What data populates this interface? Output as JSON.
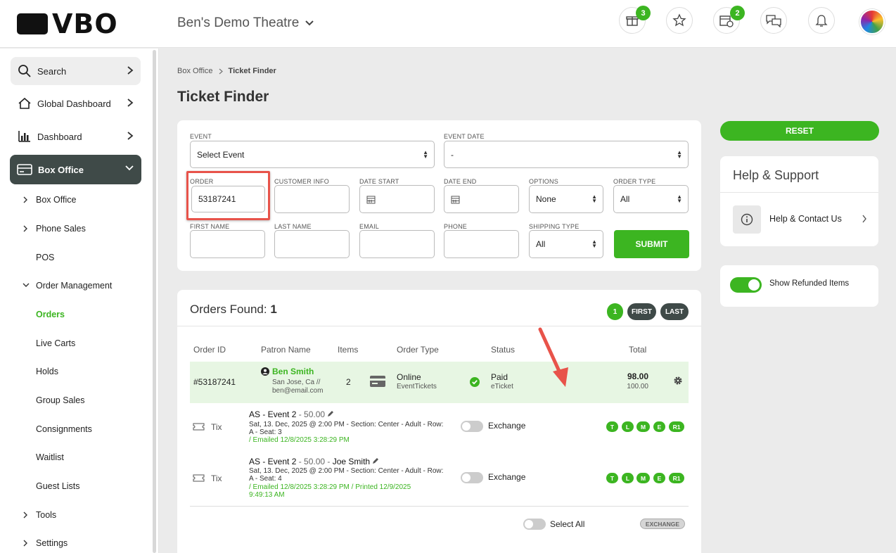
{
  "brand": {
    "logo_text": "VBO",
    "venue": "Ben's Demo Theatre"
  },
  "topbar": {
    "icons": [
      {
        "name": "gift-icon",
        "badge": "3"
      },
      {
        "name": "star-icon",
        "badge": ""
      },
      {
        "name": "calendar-clock-icon",
        "badge": "2"
      },
      {
        "name": "chat-icon",
        "badge": ""
      },
      {
        "name": "bell-icon",
        "badge": ""
      }
    ]
  },
  "sidebar": {
    "search": "Search",
    "global_dashboard": "Global Dashboard",
    "dashboard": "Dashboard",
    "box_office": "Box Office",
    "items": [
      "Box Office",
      "Phone Sales",
      "POS",
      "Order Management",
      "Orders",
      "Live Carts",
      "Holds",
      "Group Sales",
      "Consignments",
      "Waitlist",
      "Guest Lists",
      "Tools",
      "Settings"
    ]
  },
  "breadcrumb": {
    "root": "Box Office",
    "current": "Ticket Finder"
  },
  "page_title": "Ticket Finder",
  "form": {
    "event_label": "EVENT",
    "event_value": "Select Event",
    "event_date_label": "EVENT DATE",
    "event_date_value": "-",
    "order_label": "ORDER",
    "order_value": "53187241",
    "customer_info_label": "CUSTOMER INFO",
    "date_start_label": "DATE START",
    "date_end_label": "DATE END",
    "options_label": "OPTIONS",
    "options_value": "None",
    "order_type_label": "ORDER TYPE",
    "order_type_value": "All",
    "first_name_label": "FIRST NAME",
    "last_name_label": "LAST NAME",
    "email_label": "EMAIL",
    "phone_label": "PHONE",
    "shipping_label": "SHIPPING TYPE",
    "shipping_value": "All",
    "submit": "SUBMIT"
  },
  "results": {
    "title": "Orders Found:",
    "count": "1",
    "page": "1",
    "first": "FIRST",
    "last": "LAST",
    "headers": {
      "order_id": "Order ID",
      "patron": "Patron Name",
      "items": "Items",
      "order_type": "Order Type",
      "status": "Status",
      "total": "Total"
    },
    "order": {
      "id": "#53187241",
      "patron": "Ben Smith",
      "location": "San Jose, Ca //",
      "email": "ben@email.com",
      "items": "2",
      "type": "Online",
      "type_sub": "EventTickets",
      "status": "Paid",
      "status_sub": "eTicket",
      "total": "98.00",
      "total_sub": "100.00"
    },
    "tickets": [
      {
        "kind": "Tix",
        "event": "AS - Event 2",
        "price": " - 50.00",
        "holder": "",
        "desc": "Sat, 13. Dec, 2025 @ 2:00 PM - Section: Center - Adult - Row:",
        "desc2": "A - Seat: 3",
        "note": "/ Emailed 12/8/2025 3:28:29 PM",
        "note2": "",
        "exchange": "Exchange"
      },
      {
        "kind": "Tix",
        "event": "AS - Event 2",
        "price": " - 50.00 - ",
        "holder": "Joe Smith",
        "desc": "Sat, 13. Dec, 2025 @ 2:00 PM - Section: Center - Adult - Row:",
        "desc2": "A - Seat: 4",
        "note": "/ Emailed 12/8/2025 3:28:29 PM / Printed 12/9/2025",
        "note2": "9:49:13 AM",
        "exchange": "Exchange"
      }
    ],
    "chips": [
      "T",
      "L",
      "M",
      "E",
      "R1"
    ],
    "select_all": "Select All",
    "exchange_btn": "EXCHANGE"
  },
  "right": {
    "reset": "RESET",
    "help_title": "Help & Support",
    "help_link": "Help & Contact Us",
    "show_refunded": "Show Refunded Items"
  },
  "colors": {
    "accent": "#3cb521",
    "dark": "#3f4a48",
    "annotation": "#e8534a"
  }
}
